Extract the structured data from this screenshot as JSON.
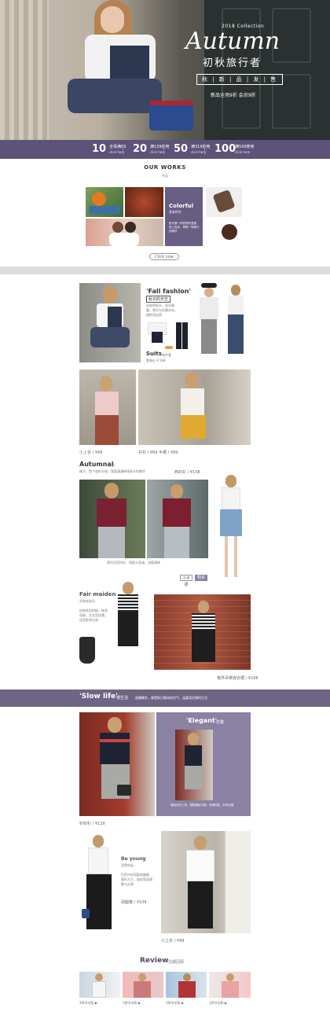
{
  "hero": {
    "collection_small": "2018 Collection",
    "script_title": "Autumn",
    "cn_title": "初秋旅行者",
    "tag": "秋 | 新 | 品 | 发 | 售",
    "note": "新品全场9折 会员9折"
  },
  "coupons": [
    {
      "num": "10",
      "label": "全场满89",
      "sub": "click here"
    },
    {
      "num": "20",
      "label": "满139使用",
      "sub": "click here"
    },
    {
      "num": "50",
      "label": "满319使用",
      "sub": "click here"
    },
    {
      "num": "100",
      "label": "满599使用",
      "sub": "click here"
    }
  ],
  "works": {
    "title": "OUR WORKS",
    "subtitle": "作品",
    "colorful_title": "Colorful",
    "colorful_sub": "多彩时节",
    "colorful_desc": "秋天第一杯奶茶的温柔，穿上色彩，享受一场旅行的美好",
    "button": "Click now"
  },
  "fall": {
    "title": "'Fall fashion'",
    "sub": "秋日的天空",
    "desc": "初秋的街头，阳光微暖，简约与优雅并存，随性而自然",
    "suits_title": "Suits",
    "suits_sub": "两件套",
    "suits_price": "套装价 ¥",
    "suits_price_num": "288",
    "cap_left": "小上衣 / ¥",
    "cap_left_num": "99",
    "cap_right": "衬衫 / ¥",
    "cap_right_num": "89",
    "cap_right2": "半裙 / ¥",
    "cap_right2_num": "89"
  },
  "autumnal": {
    "title": "Autumnal",
    "sub": "秋意",
    "desc": "格尺、首个塑的天地，我要漫漫带领秋天的脚步",
    "price_label": "西衬衫 / ¥",
    "price_num": "138",
    "center_desc": "简约百搭衬衫，搭配半身裙，显瘦高挑",
    "btn1": "小半裙",
    "btn2": "购买"
  },
  "maiden": {
    "title": "Fair maiden",
    "sub": "学院淑女风",
    "desc": "经典条纹拼接，修身显瘦，文艺而优雅，适合秋季出游",
    "caption": "格界吊带连衣裙 / ¥",
    "caption_num": "168"
  },
  "slow": {
    "title": "'Slow life'",
    "sub": "慢生活",
    "desc": "放慢脚步，感受秋日微凉的空气，温柔而优雅的生活"
  },
  "elegant": {
    "title": "'Elegant'",
    "sub": "优雅",
    "desc": "撞色针织上衣，搭配格纹半裙，优雅知性，时尚百搭",
    "caption": "针织衫 / ¥",
    "caption_num": "129"
  },
  "beyoung": {
    "title": "Be young",
    "sub": "活得年轻",
    "desc": "白色衬衫搭配阔腿裤，简约大方，轻松驾驭通勤与出游",
    "caption": "阔腿裤 / ¥",
    "caption_num": "109",
    "caption2": "小上衣 / ¥",
    "caption2_num": "99"
  },
  "review": {
    "title": "Review",
    "sub": "往期回顾",
    "items": [
      "2季节半款 ▶",
      "1季节半款 ▶",
      "3季节半款 ▶",
      "1季节半款 ▶"
    ]
  },
  "colors": {
    "purple": "#5d5278",
    "purple_light": "#8a81a3",
    "band": "#6e6585"
  }
}
